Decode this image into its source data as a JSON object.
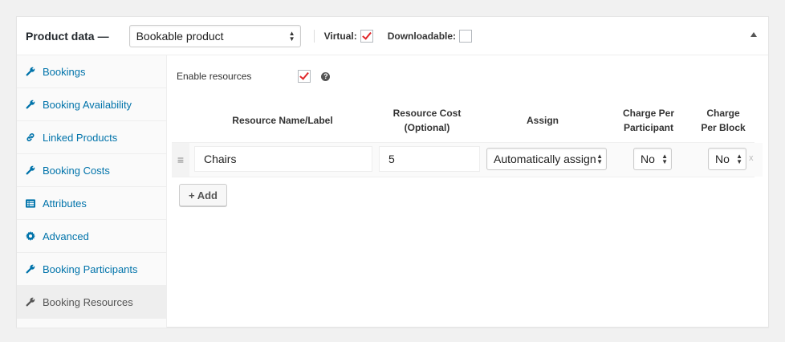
{
  "header": {
    "title": "Product data",
    "dash": "—",
    "product_type": "Bookable product",
    "virtual_label": "Virtual:",
    "virtual_checked": true,
    "downloadable_label": "Downloadable:",
    "downloadable_checked": false
  },
  "sidebar": {
    "items": [
      {
        "label": "Bookings",
        "icon": "wrench-icon"
      },
      {
        "label": "Booking Availability",
        "icon": "wrench-icon"
      },
      {
        "label": "Linked Products",
        "icon": "link-icon"
      },
      {
        "label": "Booking Costs",
        "icon": "wrench-icon"
      },
      {
        "label": "Attributes",
        "icon": "list-icon"
      },
      {
        "label": "Advanced",
        "icon": "gear-icon"
      },
      {
        "label": "Booking Participants",
        "icon": "wrench-icon"
      },
      {
        "label": "Booking Resources",
        "icon": "wrench-icon",
        "active": true
      }
    ]
  },
  "resources": {
    "enable_label": "Enable resources",
    "enable_checked": true,
    "help": "?",
    "columns": {
      "name": "Resource Name/Label",
      "cost_line1": "Resource Cost",
      "cost_line2": "(Optional)",
      "assign": "Assign",
      "participant_line1": "Charge Per",
      "participant_line2": "Participant",
      "block_line1": "Charge",
      "block_line2": "Per Block"
    },
    "rows": [
      {
        "name": "Chairs",
        "cost": "5",
        "assign": "Automatically assigned",
        "charge_per_participant": "No",
        "charge_per_block": "No",
        "remove": "x"
      }
    ],
    "add_button": "+ Add"
  },
  "colors": {
    "link": "#0073aa",
    "check": "#e0272a",
    "panel_bg": "#ffffff",
    "page_bg": "#f1f1f1"
  }
}
